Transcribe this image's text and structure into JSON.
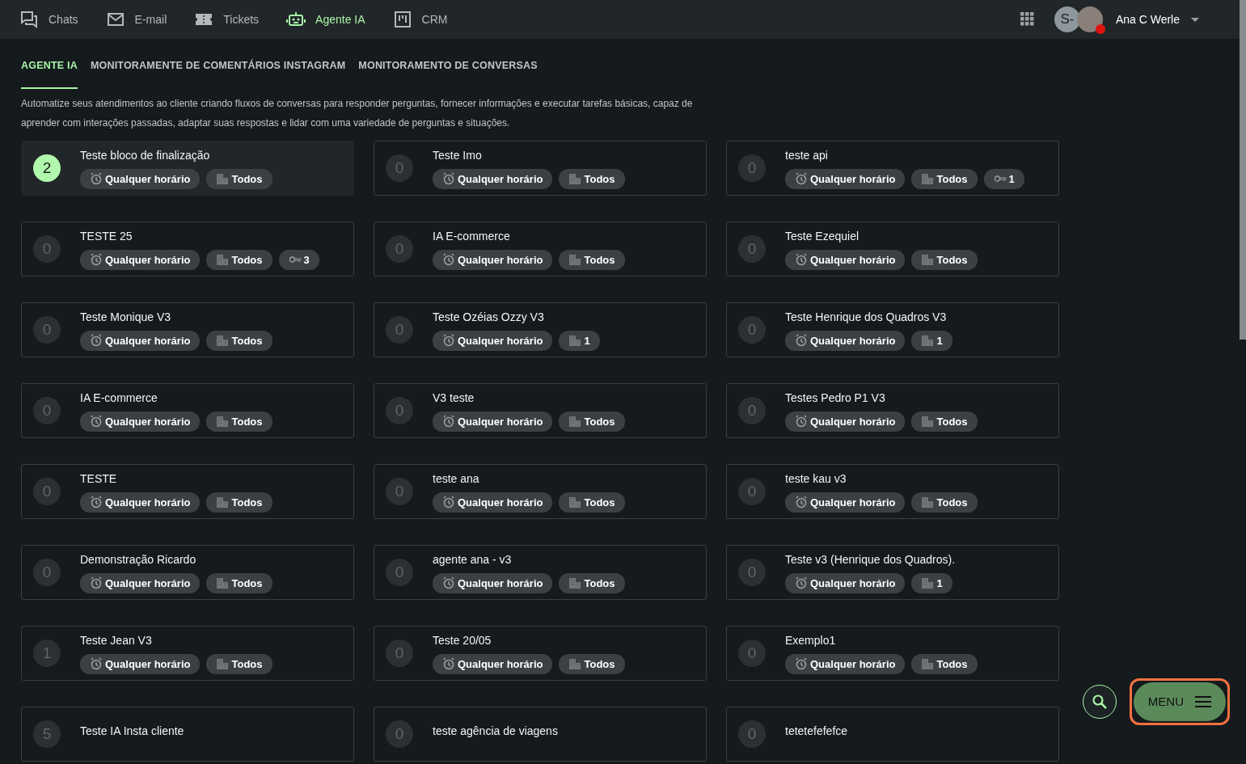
{
  "topnav": {
    "items": [
      {
        "label": "Chats",
        "selected": false
      },
      {
        "label": "E-mail",
        "selected": false
      },
      {
        "label": "Tickets",
        "selected": false
      },
      {
        "label": "Agente IA",
        "selected": true
      },
      {
        "label": "CRM",
        "selected": false
      }
    ],
    "user": {
      "initials": "S-",
      "name": "Ana C Werle"
    }
  },
  "tabs": [
    {
      "label": "AGENTE IA",
      "selected": true
    },
    {
      "label": "MONITORAMENTE DE COMENTÁRIOS INSTAGRAM",
      "selected": false
    },
    {
      "label": "MONITORAMENTO DE CONVERSAS",
      "selected": false
    }
  ],
  "description": "Automatize seus atendimentos ao cliente criando fluxos de conversas para responder perguntas, fornecer informações e executar tarefas básicas, capaz de aprender com interações passadas, adaptar suas respostas e lidar com uma variedade de perguntas e situações.",
  "agents": [
    {
      "name": "Teste bloco de finalização",
      "count": "2",
      "selected": true,
      "schedule": "Qualquer horário",
      "units": "Todos"
    },
    {
      "name": "Teste Imo",
      "count": "0",
      "selected": false,
      "schedule": "Qualquer horário",
      "units": "Todos"
    },
    {
      "name": "teste api",
      "count": "0",
      "selected": false,
      "schedule": "Qualquer horário",
      "units": "Todos",
      "keys": "1"
    },
    {
      "name": "TESTE 25",
      "count": "0",
      "selected": false,
      "schedule": "Qualquer horário",
      "units": "Todos",
      "keys": "3"
    },
    {
      "name": "IA E-commerce",
      "count": "0",
      "selected": false,
      "schedule": "Qualquer horário",
      "units": "Todos"
    },
    {
      "name": "Teste Ezequiel",
      "count": "0",
      "selected": false,
      "schedule": "Qualquer horário",
      "units": "Todos"
    },
    {
      "name": "Teste Monique V3",
      "count": "0",
      "selected": false,
      "schedule": "Qualquer horário",
      "units": "Todos"
    },
    {
      "name": "Teste Ozéias Ozzy V3",
      "count": "0",
      "selected": false,
      "schedule": "Qualquer horário",
      "units": "1"
    },
    {
      "name": "Teste Henrique dos Quadros V3",
      "count": "0",
      "selected": false,
      "schedule": "Qualquer horário",
      "units": "1"
    },
    {
      "name": "IA E-commerce",
      "count": "0",
      "selected": false,
      "schedule": "Qualquer horário",
      "units": "Todos"
    },
    {
      "name": "V3 teste",
      "count": "0",
      "selected": false,
      "schedule": "Qualquer horário",
      "units": "Todos"
    },
    {
      "name": "Testes Pedro P1 V3",
      "count": "0",
      "selected": false,
      "schedule": "Qualquer horário",
      "units": "Todos"
    },
    {
      "name": "TESTE",
      "count": "0",
      "selected": false,
      "schedule": "Qualquer horário",
      "units": "Todos"
    },
    {
      "name": "teste ana",
      "count": "0",
      "selected": false,
      "schedule": "Qualquer horário",
      "units": "Todos"
    },
    {
      "name": "teste kau v3",
      "count": "0",
      "selected": false,
      "schedule": "Qualquer horário",
      "units": "Todos"
    },
    {
      "name": "Demonstração Ricardo",
      "count": "0",
      "selected": false,
      "schedule": "Qualquer horário",
      "units": "Todos"
    },
    {
      "name": "agente ana - v3",
      "count": "0",
      "selected": false,
      "schedule": "Qualquer horário",
      "units": "Todos"
    },
    {
      "name": "Teste v3 (Henrique dos Quadros).",
      "count": "0",
      "selected": false,
      "schedule": "Qualquer horário",
      "units": "1"
    },
    {
      "name": "Teste Jean V3",
      "count": "1",
      "selected": false,
      "schedule": "Qualquer horário",
      "units": "Todos"
    },
    {
      "name": "Teste 20/05",
      "count": "0",
      "selected": false,
      "schedule": "Qualquer horário",
      "units": "Todos"
    },
    {
      "name": "Exemplo1",
      "count": "0",
      "selected": false,
      "schedule": "Qualquer horário",
      "units": "Todos"
    },
    {
      "name": "Teste IA Insta cliente",
      "count": "5",
      "selected": false
    },
    {
      "name": "teste agência de viagens",
      "count": "0",
      "selected": false
    },
    {
      "name": "tetetefefefce",
      "count": "0",
      "selected": false
    }
  ],
  "menu_button": {
    "label": "MENU"
  }
}
